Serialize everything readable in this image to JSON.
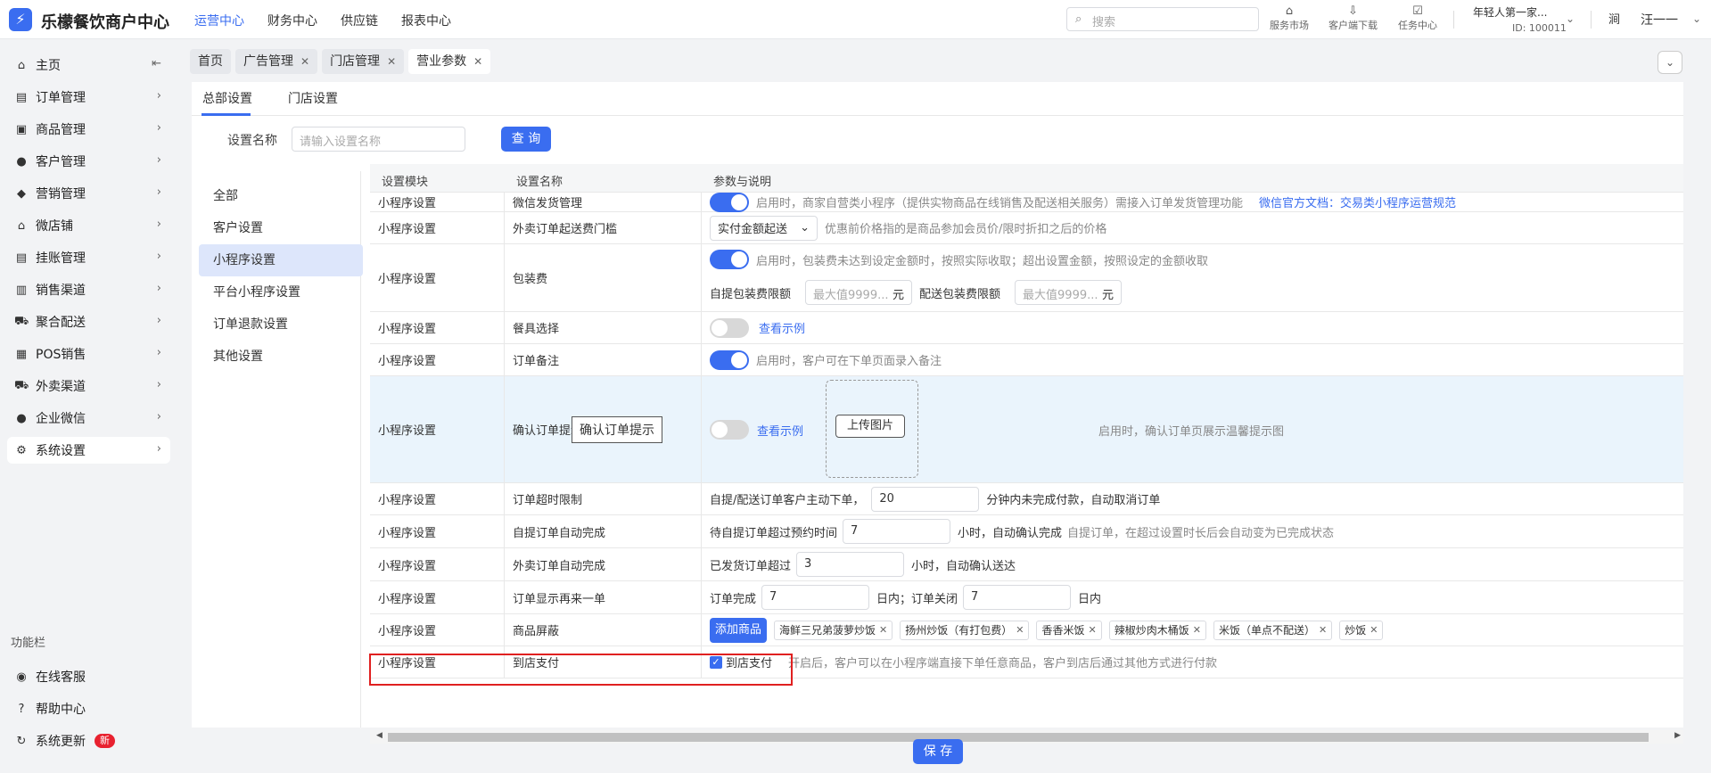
{
  "brand": {
    "name": "乐檬餐饮商户中心"
  },
  "topnav": [
    "运营中心",
    "财务中心",
    "供应链",
    "报表中心"
  ],
  "search": {
    "placeholder": "搜索"
  },
  "tools": [
    {
      "label": "服务市场",
      "icon": "store-icon"
    },
    {
      "label": "客户端下载",
      "icon": "download-folder-icon"
    },
    {
      "label": "任务中心",
      "icon": "task-icon"
    }
  ],
  "store": {
    "name": "年轻人第一家...",
    "id": "ID: 100011"
  },
  "user": {
    "name": "汪一一"
  },
  "sidebar": {
    "items": [
      {
        "label": "主页",
        "icon": "home-icon"
      },
      {
        "label": "订单管理",
        "icon": "order-icon"
      },
      {
        "label": "商品管理",
        "icon": "goods-icon"
      },
      {
        "label": "客户管理",
        "icon": "customer-icon"
      },
      {
        "label": "营销管理",
        "icon": "tag-icon"
      },
      {
        "label": "微店铺",
        "icon": "shop-icon"
      },
      {
        "label": "挂账管理",
        "icon": "ledger-icon"
      },
      {
        "label": "销售渠道",
        "icon": "bank-icon"
      },
      {
        "label": "聚合配送",
        "icon": "delivery-icon"
      },
      {
        "label": "POS销售",
        "icon": "pos-icon"
      },
      {
        "label": "外卖渠道",
        "icon": "scooter-icon"
      },
      {
        "label": "企业微信",
        "icon": "chat-icon"
      },
      {
        "label": "系统设置",
        "icon": "gear-icon"
      }
    ],
    "section_title": "功能栏",
    "bottom": [
      {
        "label": "在线客服",
        "icon": "support-icon"
      },
      {
        "label": "帮助中心",
        "icon": "help-icon"
      },
      {
        "label": "系统更新",
        "icon": "refresh-icon",
        "badge": "新"
      }
    ]
  },
  "tabs": [
    "首页",
    "广告管理",
    "门店管理",
    "营业参数"
  ],
  "subtabs": [
    "总部设置",
    "门店设置"
  ],
  "filter": {
    "label": "设置名称",
    "placeholder": "请输入设置名称",
    "button": "查 询"
  },
  "categories": [
    "全部",
    "客户设置",
    "小程序设置",
    "平台小程序设置",
    "订单退款设置",
    "其他设置"
  ],
  "table": {
    "headers": [
      "设置模块",
      "设置名称",
      "参数与说明"
    ],
    "rows": [
      {
        "module": "小程序设置",
        "name": "微信发货管理",
        "desc": "启用时，商家自营类小程序（提供实物商品在线销售及配送相关服务）需接入订单发货管理功能",
        "link_label": "微信官方文档：",
        "link": "交易类小程序运营规范"
      },
      {
        "module": "小程序设置",
        "name": "外卖订单起送费门槛",
        "select": "实付金额起送",
        "desc": "优惠前价格指的是商品参加会员价/限时折扣之后的价格"
      },
      {
        "module": "小程序设置",
        "name": "包装费",
        "desc": "启用时，包装费未达到设定金额时，按照实际收取；超出设置金额，按照设定的金额收取",
        "self_label": "自提包装费限额",
        "self_placeholder": "最大值9999...",
        "unit": "元",
        "deliv_label": "配送包装费限额",
        "deliv_placeholder": "最大值9999..."
      },
      {
        "module": "小程序设置",
        "name": "餐具选择",
        "link": "查看示例"
      },
      {
        "module": "小程序设置",
        "name": "订单备注",
        "desc": "启用时，客户可在下单页面录入备注"
      },
      {
        "module": "小程序设置",
        "name": "确认订单提示",
        "tooltip": "确认订单提示",
        "link": "查看示例",
        "upload": "上传图片",
        "desc": "启用时，确认订单页展示温馨提示图"
      },
      {
        "module": "小程序设置",
        "name": "订单超时限制",
        "pre": "自提/配送订单客户主动下单，",
        "value": "20",
        "post": "分钟内未完成付款，自动取消订单"
      },
      {
        "module": "小程序设置",
        "name": "自提订单自动完成",
        "pre": "待自提订单超过预约时间",
        "value": "7",
        "post": "小时，自动确认完成",
        "note": "自提订单，在超过设置时长后会自动变为已完成状态"
      },
      {
        "module": "小程序设置",
        "name": "外卖订单自动完成",
        "pre": "已发货订单超过",
        "value": "3",
        "post": "小时，自动确认送达"
      },
      {
        "module": "小程序设置",
        "name": "订单显示再来一单",
        "pre": "订单完成",
        "value": "7",
        "mid": "日内；订单关闭",
        "value2": "7",
        "post": "日内"
      },
      {
        "module": "小程序设置",
        "name": "商品屏蔽",
        "button": "添加商品",
        "tags": [
          "海鲜三兄弟菠萝炒饭",
          "扬州炒饭（有打包费）",
          "香香米饭",
          "辣椒炒肉木桶饭",
          "米饭（单点不配送）",
          "炒饭"
        ]
      },
      {
        "module": "小程序设置",
        "name": "到店支付",
        "checkbox": "到店支付",
        "desc": "开启后，客户可以在小程序端直接下单任意商品，客户到店后通过其他方式进行付款"
      }
    ]
  },
  "save": "保 存",
  "colors": {
    "accent": "#3a6df0",
    "highlight_row": "#eaf4fc",
    "red_box": "#e02020"
  }
}
